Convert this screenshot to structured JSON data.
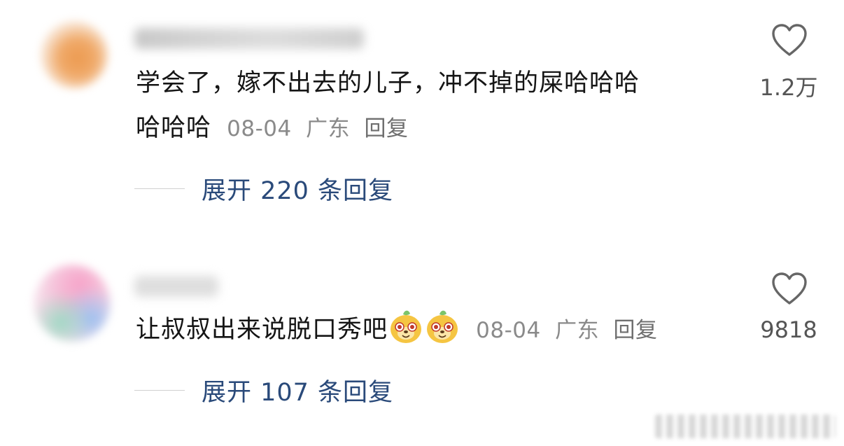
{
  "comments": [
    {
      "line1": "学会了，嫁不出去的儿子，冲不掉的屎哈哈哈",
      "line2": "哈哈哈",
      "date": "08-04",
      "location": "广东",
      "reply_label": "回复",
      "likes": "1.2万",
      "expand_label": "展开 220 条回复"
    },
    {
      "line1": "让叔叔出来说脱口秀吧",
      "date": "08-04",
      "location": "广东",
      "reply_label": "回复",
      "likes": "9818",
      "expand_label": "展开 107 条回复",
      "emojis": [
        "dog-face-emoji",
        "dog-face-emoji"
      ]
    }
  ],
  "icons": {
    "like": "heart-outline-icon"
  },
  "colors": {
    "expand_link": "#2a4a7a",
    "meta_text": "#8a8a8a",
    "like_count": "#555555"
  }
}
